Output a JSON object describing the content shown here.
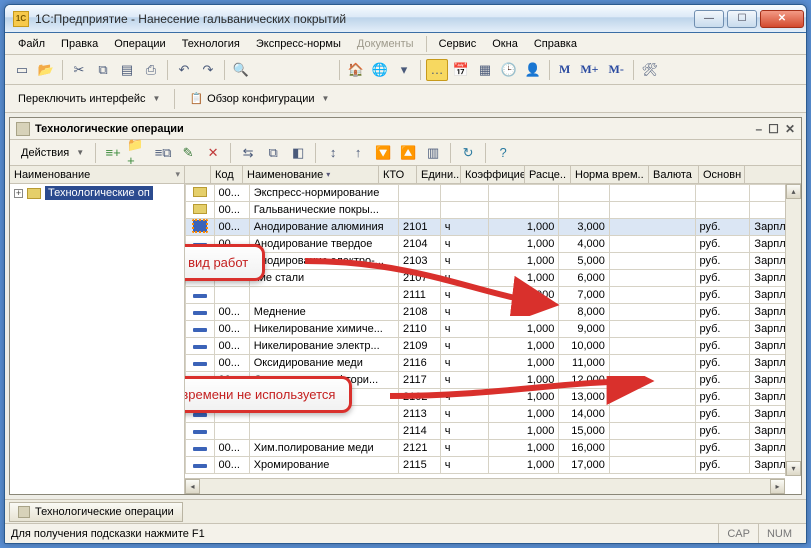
{
  "window": {
    "title": "1С:Предприятие - Нанесение гальванических покрытий"
  },
  "menu": {
    "items": [
      "Файл",
      "Правка",
      "Операции",
      "Технология",
      "Экспресс-нормы",
      "Документы",
      "Сервис",
      "Окна",
      "Справка"
    ],
    "disabled_index": 5
  },
  "toolbar2": {
    "switch_interface": "Переключить интерфейс",
    "config_overview": "Обзор конфигурации"
  },
  "inner": {
    "title": "Технологические операции",
    "actions_label": "Действия",
    "tree_header": "Наименование",
    "tree_item": "Технологические оп"
  },
  "grid": {
    "columns": [
      "",
      "Код",
      "Наименование",
      "КТО",
      "Едини..",
      "Коэффицие..",
      "Расце..",
      "Норма врем..",
      "Валюта",
      "Основн"
    ],
    "rows": [
      {
        "type": "folder",
        "code": "00...",
        "name": "Экспресс-нормирование"
      },
      {
        "type": "folder",
        "code": "00...",
        "name": "Гальванические покры..."
      },
      {
        "type": "item",
        "sel": true,
        "code": "00...",
        "name": "Анодирование алюминия",
        "kto": "2101",
        "unit": "ч",
        "coef": "1,000",
        "rate": "3,000",
        "norm": "",
        "cur": "руб.",
        "base": "Зарпла"
      },
      {
        "type": "item",
        "code": "00...",
        "name": "Анодирование твердое",
        "kto": "2104",
        "unit": "ч",
        "coef": "1,000",
        "rate": "4,000",
        "norm": "",
        "cur": "руб.",
        "base": "Зарпла"
      },
      {
        "type": "item",
        "code": "00...",
        "name": "Анодирование электро-...",
        "kto": "2103",
        "unit": "ч",
        "coef": "1,000",
        "rate": "5,000",
        "norm": "",
        "cur": "руб.",
        "base": "Зарпла"
      },
      {
        "type": "item",
        "code": "",
        "name": "ние стали",
        "kto": "2107",
        "unit": "ч",
        "coef": "1,000",
        "rate": "6,000",
        "norm": "",
        "cur": "руб.",
        "base": "Зарпла"
      },
      {
        "type": "item",
        "code": "",
        "name": "",
        "kto": "2111",
        "unit": "ч",
        "coef": "1,000",
        "rate": "7,000",
        "norm": "",
        "cur": "руб.",
        "base": "Зарпла"
      },
      {
        "type": "item",
        "code": "00...",
        "name": "Меднение",
        "kto": "2108",
        "unit": "ч",
        "coef": "",
        "rate": "8,000",
        "norm": "",
        "cur": "руб.",
        "base": "Зарпла"
      },
      {
        "type": "item",
        "code": "00...",
        "name": "Никелирование химиче...",
        "kto": "2110",
        "unit": "ч",
        "coef": "1,000",
        "rate": "9,000",
        "norm": "",
        "cur": "руб.",
        "base": "Зарпла"
      },
      {
        "type": "item",
        "code": "00...",
        "name": "Никелирование электр...",
        "kto": "2109",
        "unit": "ч",
        "coef": "1,000",
        "rate": "10,000",
        "norm": "",
        "cur": "руб.",
        "base": "Зарпла"
      },
      {
        "type": "item",
        "code": "00...",
        "name": "Оксидирование меди",
        "kto": "2116",
        "unit": "ч",
        "coef": "1,000",
        "rate": "11,000",
        "norm": "",
        "cur": "руб.",
        "base": "Зарпла"
      },
      {
        "type": "item",
        "code": "00...",
        "name": "Оксидирование фтори...",
        "kto": "2117",
        "unit": "ч",
        "coef": "1,000",
        "rate": "12,000",
        "norm": "",
        "cur": "руб.",
        "base": "Зарпла"
      },
      {
        "type": "item",
        "code": "",
        "name": "",
        "kto": "2102",
        "unit": "ч",
        "coef": "1,000",
        "rate": "13,000",
        "norm": "",
        "cur": "руб.",
        "base": "Зарпла"
      },
      {
        "type": "item",
        "code": "",
        "name": "",
        "kto": "2113",
        "unit": "ч",
        "coef": "1,000",
        "rate": "14,000",
        "norm": "",
        "cur": "руб.",
        "base": "Зарпла"
      },
      {
        "type": "item",
        "code": "",
        "name": "",
        "kto": "2114",
        "unit": "ч",
        "coef": "1,000",
        "rate": "15,000",
        "norm": "",
        "cur": "руб.",
        "base": "Зарпла"
      },
      {
        "type": "item",
        "code": "00...",
        "name": "Хим.полирование меди",
        "kto": "2121",
        "unit": "ч",
        "coef": "1,000",
        "rate": "16,000",
        "norm": "",
        "cur": "руб.",
        "base": "Зарпла"
      },
      {
        "type": "item",
        "code": "00...",
        "name": "Хромирование",
        "kto": "2115",
        "unit": "ч",
        "coef": "1,000",
        "rate": "17,000",
        "norm": "",
        "cur": "руб.",
        "base": "Зарпла"
      }
    ]
  },
  "callouts": {
    "rate": "Единая расценка на вид работ",
    "norm": "Реквизит норма времени не используется"
  },
  "taskbar": {
    "item": "Технологические операции"
  },
  "status": {
    "hint": "Для получения подсказки нажмите F1",
    "cap": "CAP",
    "num": "NUM"
  }
}
